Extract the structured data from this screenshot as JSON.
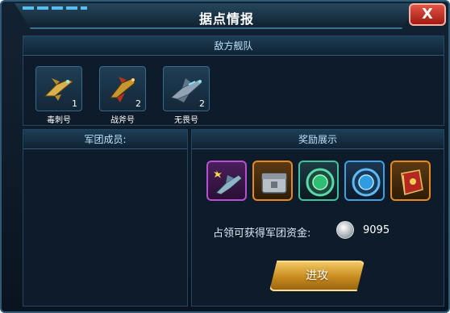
{
  "dialog": {
    "title": "据点情报",
    "close_label": "X"
  },
  "enemy_fleet": {
    "header": "敌方舰队",
    "ships": [
      {
        "name": "毒刺号",
        "count": "1",
        "icon": "gold-fighter-ship-icon"
      },
      {
        "name": "战斧号",
        "count": "2",
        "icon": "red-gold-fighter-ship-icon"
      },
      {
        "name": "无畏号",
        "count": "2",
        "icon": "blue-cruiser-ship-icon"
      }
    ]
  },
  "legion_members": {
    "header": "军团成员:"
  },
  "rewards": {
    "header": "奖励展示",
    "items": [
      {
        "icon": "purple-ship-blueprint-icon",
        "frame_color": "#b64fd1"
      },
      {
        "icon": "metal-crate-icon",
        "frame_color": "#e68a1f"
      },
      {
        "icon": "green-module-icon",
        "frame_color": "#3fc2a0"
      },
      {
        "icon": "blue-module-icon",
        "frame_color": "#3f9fe0"
      },
      {
        "icon": "red-book-icon",
        "frame_color": "#e68a1f"
      }
    ],
    "funds_label": "占领可获得军团资金:",
    "funds_icon": "silver-coin-icon",
    "funds_value": "9095",
    "attack_label": "进攻"
  }
}
